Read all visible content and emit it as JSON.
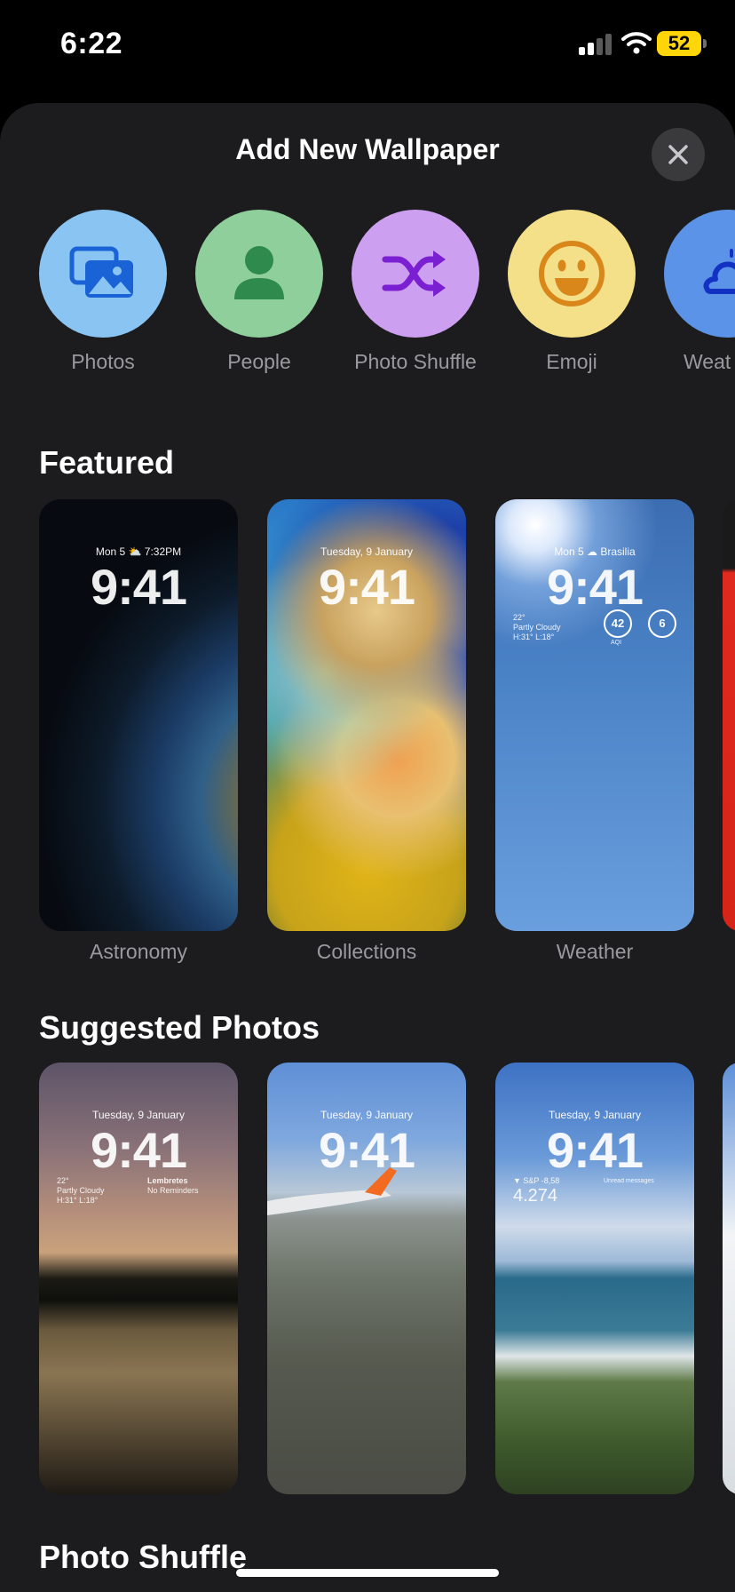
{
  "status_bar": {
    "time": "6:22",
    "battery": "52"
  },
  "sheet": {
    "title": "Add New Wallpaper"
  },
  "categories": [
    {
      "label": "Photos",
      "color": "#8ac4f2",
      "icon": "photos-icon"
    },
    {
      "label": "People",
      "color": "#8ecf9c",
      "icon": "person-icon"
    },
    {
      "label": "Photo Shuffle",
      "color": "#cd9ff0",
      "icon": "shuffle-icon"
    },
    {
      "label": "Emoji",
      "color": "#f5e08a",
      "icon": "smiley-icon"
    },
    {
      "label": "Weat",
      "color": "#5b93e8",
      "icon": "weather-icon"
    }
  ],
  "featured": {
    "title": "Featured",
    "cards": [
      {
        "label": "Astronomy",
        "date": "Mon 5  ⛅ 7:32PM",
        "clock": "9:41"
      },
      {
        "label": "Collections",
        "date": "Tuesday, 9 January",
        "clock": "9:41"
      },
      {
        "label": "Weather",
        "date": "Mon 5  ☁ Brasilia",
        "clock": "9:41",
        "widget_temp": "22°",
        "widget_cond": "Partly Cloudy",
        "widget_hl": "H:31° L:18°",
        "aqi": "42",
        "aqi_label": "AQI",
        "uv": "6"
      }
    ]
  },
  "suggested": {
    "title": "Suggested Photos",
    "cards": [
      {
        "date": "Tuesday, 9 January",
        "clock": "9:41",
        "widget_temp": "22°",
        "widget_cond": "Partly Cloudy",
        "widget_hl": "H:31° L:18°",
        "widget_title": "Lembretes",
        "widget_sub": "No Reminders"
      },
      {
        "date": "Tuesday, 9 January",
        "clock": "9:41"
      },
      {
        "date": "Tuesday, 9 January",
        "clock": "9:41",
        "stock_name": "▼ S&P -8,58",
        "stock_value": "4.274",
        "messages": "Unread messages"
      }
    ]
  },
  "shuffle_section": {
    "title": "Photo Shuffle"
  }
}
